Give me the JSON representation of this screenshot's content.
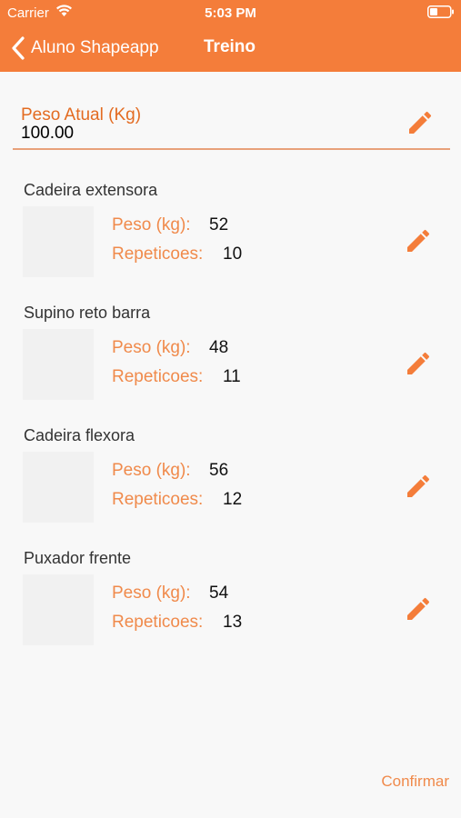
{
  "status_bar": {
    "carrier": "Carrier",
    "time": "5:03 PM"
  },
  "nav": {
    "back_label": "Aluno Shapeapp",
    "title": "Treino"
  },
  "weight": {
    "label": "Peso Atual (Kg)",
    "value": "100.00"
  },
  "labels": {
    "peso": "Peso (kg):",
    "repeticoes": "Repeticoes:"
  },
  "exercises": [
    {
      "name": "Cadeira extensora",
      "peso": "52",
      "repeticoes": "10"
    },
    {
      "name": "Supino reto barra",
      "peso": "48",
      "repeticoes": "11"
    },
    {
      "name": "Cadeira flexora",
      "peso": "56",
      "repeticoes": "12"
    },
    {
      "name": "Puxador frente",
      "peso": "54",
      "repeticoes": "13"
    }
  ],
  "footer": {
    "confirm_label": "Confirmar"
  },
  "colors": {
    "accent": "#f47d3a",
    "label_orange": "#f08a4b",
    "background": "#f8f8f8"
  }
}
